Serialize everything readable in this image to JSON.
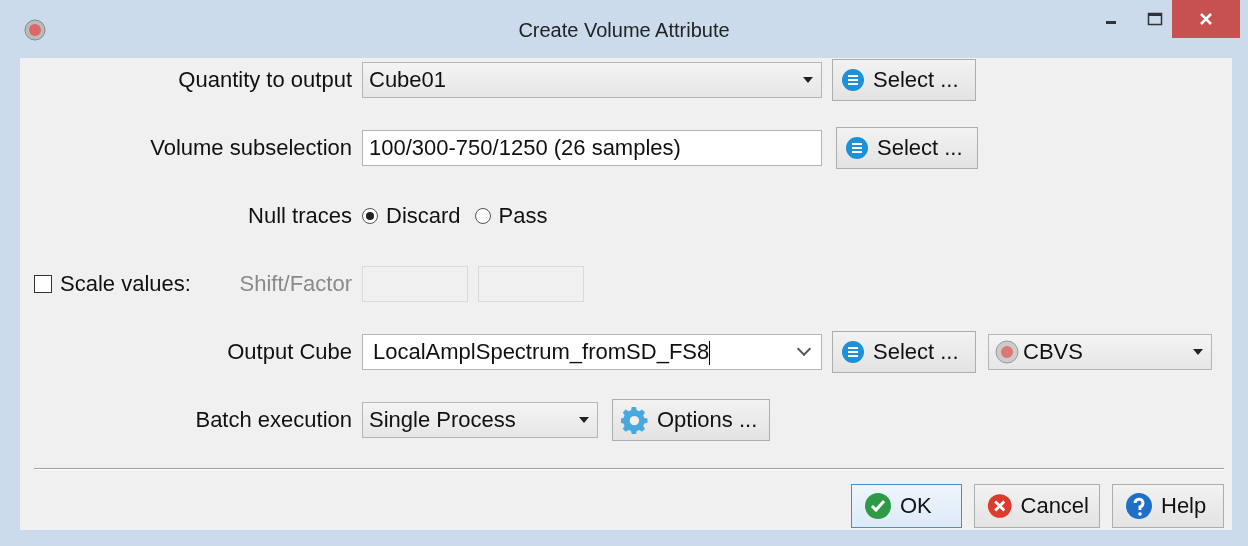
{
  "window": {
    "title": "Create Volume Attribute"
  },
  "rows": [
    {
      "kind": "combo",
      "label": "Quantity to output",
      "value": "Cube01",
      "button": "Select ..."
    },
    {
      "kind": "text",
      "label": "Volume subselection",
      "value": "100/300-750/1250 (26 samples)",
      "button": "Select ..."
    },
    {
      "kind": "radio",
      "label": "Null traces",
      "options": [
        {
          "label": "Discard",
          "selected": true
        },
        {
          "label": "Pass",
          "selected": false
        }
      ]
    },
    {
      "kind": "scale",
      "checkbox": "Scale values:",
      "checked": false,
      "label": "Shift/Factor",
      "disabled": true
    },
    {
      "kind": "output",
      "label": "Output Cube",
      "value": "LocalAmplSpectrum_fromSD_FS8",
      "button": "Select ...",
      "format": "CBVS"
    },
    {
      "kind": "batch",
      "label": "Batch execution",
      "value": "Single Process",
      "button": "Options ..."
    }
  ],
  "buttons": [
    {
      "kind": "ok",
      "label": "OK"
    },
    {
      "kind": "cancel",
      "label": "Cancel"
    },
    {
      "kind": "help",
      "label": "Help"
    }
  ]
}
